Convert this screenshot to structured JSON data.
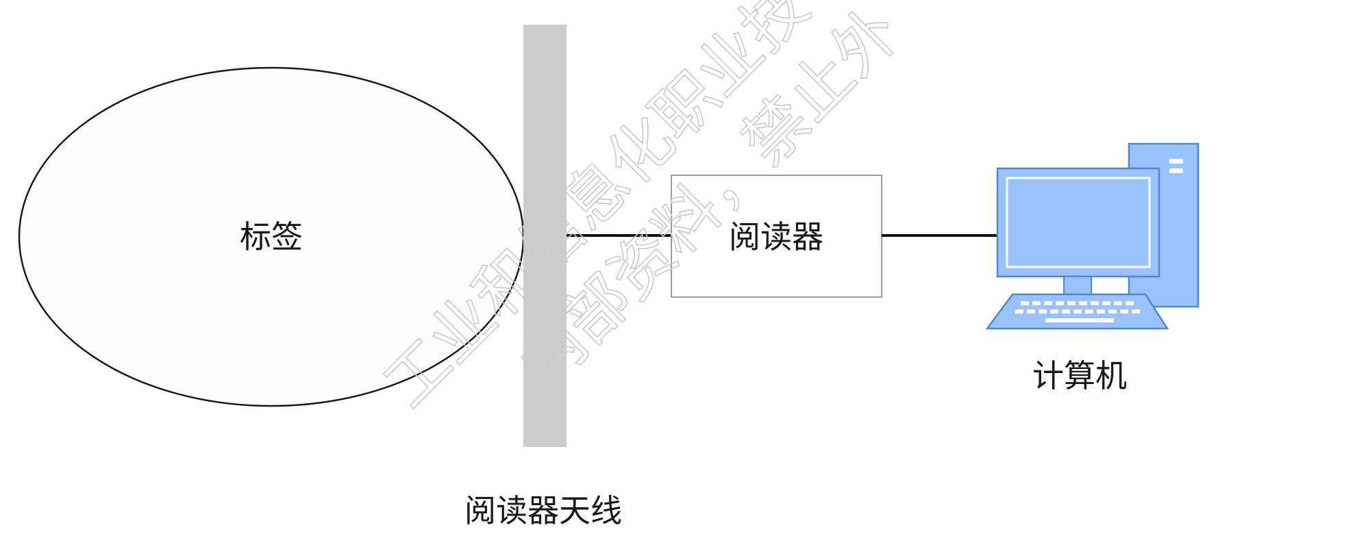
{
  "nodes": {
    "tag": {
      "label": "标签"
    },
    "antenna": {
      "label": "阅读器天线"
    },
    "reader": {
      "label": "阅读器"
    },
    "computer": {
      "label": "计算机"
    }
  },
  "watermark": {
    "line1": "工业和信息化职业技",
    "line2": "内部资料，禁止外"
  },
  "colors": {
    "antenna_fill": "#cccccc",
    "computer_fill": "#99c2ff",
    "computer_stroke": "#4d86d9",
    "outline": "#1a1a1a"
  },
  "icons": {
    "computer": "desktop-computer-icon"
  }
}
